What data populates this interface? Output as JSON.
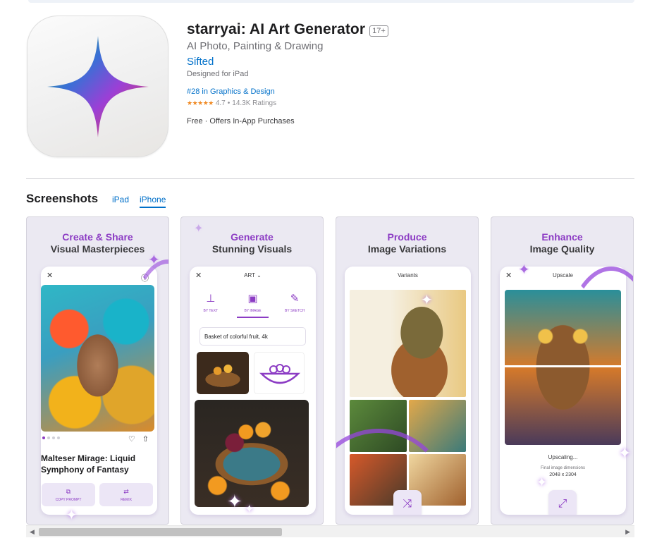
{
  "app": {
    "title": "starryai: AI Art Generator",
    "age_rating": "17+",
    "subtitle": "AI Photo, Painting & Drawing",
    "developer": "Sifted",
    "designed_for": "Designed for iPad",
    "rank": "#28 in Graphics & Design",
    "stars": "★★★★★",
    "rating": "4.7",
    "rating_separator": "•",
    "ratings_count": "14.3K Ratings",
    "price_info": "Free · Offers In-App Purchases",
    "icon": "four-point-star-icon"
  },
  "screenshots_section": {
    "title": "Screenshots",
    "tabs": [
      {
        "label": "iPad",
        "selected": false
      },
      {
        "label": "iPhone",
        "selected": true
      }
    ]
  },
  "cards": [
    {
      "headline": "Create & Share",
      "subhead": "Visual Masterpieces",
      "close": "✕",
      "art_title": "Malteser Mirage: Liquid Symphony of Fantasy",
      "buttons": [
        {
          "label": "COPY PROMPT",
          "icon": "copy-icon"
        },
        {
          "label": "REMIX",
          "icon": "remix-icon"
        }
      ]
    },
    {
      "headline": "Generate",
      "subhead": "Stunning Visuals",
      "close": "✕",
      "header": "ART ⌄",
      "modes": [
        {
          "label": "BY TEXT",
          "icon": "text-icon"
        },
        {
          "label": "BY IMAGE",
          "icon": "image-icon"
        },
        {
          "label": "BY SKETCH",
          "icon": "sketch-icon"
        }
      ],
      "prompt": "Basket of colorful fruit, 4k"
    },
    {
      "headline": "Produce",
      "subhead": "Image Variations",
      "header": "Variants"
    },
    {
      "headline": "Enhance",
      "subhead": "Image Quality",
      "close": "✕",
      "header": "Upscale",
      "status": "Upscaling...",
      "dimensions_label": "Final image dimensions",
      "dimensions": "2048 x 2304"
    }
  ],
  "colors": {
    "accent": "#8c3cc4",
    "link": "#0070c9",
    "star": "#f08a24"
  }
}
